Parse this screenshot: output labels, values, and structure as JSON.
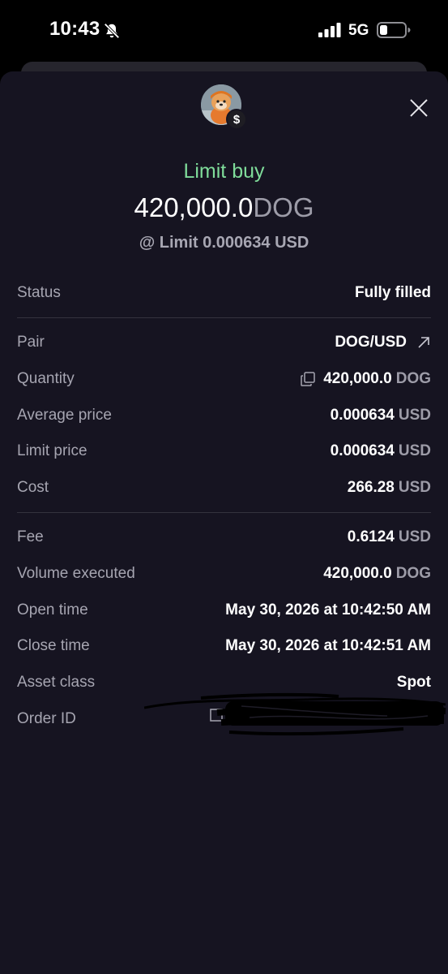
{
  "status_bar": {
    "time": "10:43",
    "network": "5G",
    "icons": [
      "bell-slash-icon",
      "signal-icon",
      "battery-icon"
    ]
  },
  "header": {
    "avatar": "dog-avatar-icon",
    "badge_symbol": "$",
    "close": "close-icon",
    "order_type": "Limit buy",
    "amount": "420,000.0",
    "amount_unit": "DOG",
    "limit_line": "@ Limit 0.000634 USD"
  },
  "details": {
    "status": {
      "label": "Status",
      "value": "Fully filled"
    },
    "pair": {
      "label": "Pair",
      "value": "DOG/USD"
    },
    "quantity": {
      "label": "Quantity",
      "value": "420,000.0",
      "unit": "DOG"
    },
    "average_price": {
      "label": "Average price",
      "value": "0.000634",
      "unit": "USD"
    },
    "limit_price": {
      "label": "Limit price",
      "value": "0.000634",
      "unit": "USD"
    },
    "cost": {
      "label": "Cost",
      "value": "266.28",
      "unit": "USD"
    },
    "fee": {
      "label": "Fee",
      "value": "0.6124",
      "unit": "USD"
    },
    "volume_executed": {
      "label": "Volume executed",
      "value": "420,000.0",
      "unit": "DOG"
    },
    "open_time": {
      "label": "Open time",
      "value": "May 30, 2026 at 10:42:50 AM"
    },
    "close_time": {
      "label": "Close time",
      "value": "May 30, 2026 at 10:42:51 AM"
    },
    "asset_class": {
      "label": "Asset class",
      "value": "Spot"
    },
    "order_id": {
      "label": "Order ID"
    }
  },
  "colors": {
    "sheet_bg": "#161421",
    "order_type": "#7fdc9a",
    "label": "#a6a5b1",
    "unit": "#9d9ca8",
    "divider": "#34333e"
  }
}
